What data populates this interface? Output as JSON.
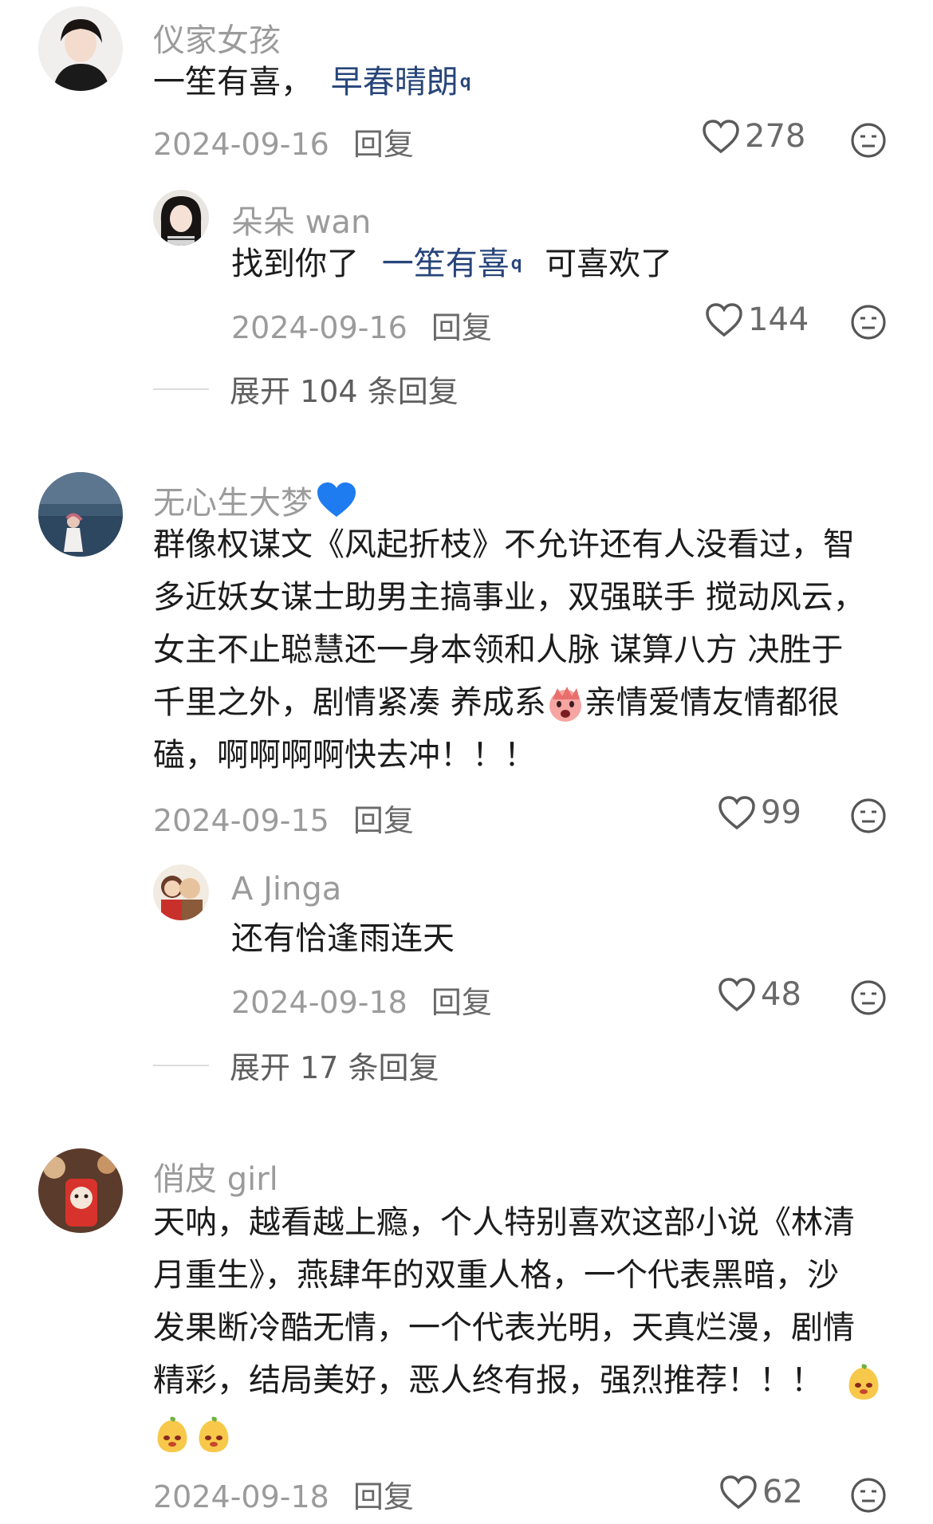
{
  "comments": [
    {
      "user": "仪家女孩",
      "text_plain": "一笙有喜，",
      "text_link": "早春晴朗",
      "date": "2024-09-16",
      "reply_label": "回复",
      "likes": "278",
      "replies": [
        {
          "user": "朵朵 wan",
          "text_plain_before": "找到你了",
          "text_link": "一笙有喜",
          "text_plain_after": "可喜欢了",
          "date": "2024-09-16",
          "reply_label": "回复",
          "likes": "144"
        }
      ],
      "expand_label": "展开 104 条回复"
    },
    {
      "user": "无心生大梦",
      "user_emoji": "blue-heart",
      "lines": [
        "群像权谋文《风起折枝》不允许还有人没看过，智",
        "多近妖女谋士助男主搞事业，双强联手 搅动风云，",
        "女主不止聪慧还一身本领和人脉 谋算八方 决胜于",
        "千里之外，剧情紧凑 养成系",
        "亲情爱情友情都很",
        "磕，啊啊啊啊快去冲！！！"
      ],
      "date": "2024-09-15",
      "reply_label": "回复",
      "likes": "99",
      "replies": [
        {
          "user": "A Jinga",
          "text": "还有恰逢雨连天",
          "date": "2024-09-18",
          "reply_label": "回复",
          "likes": "48"
        }
      ],
      "expand_label": "展开 17 条回复"
    },
    {
      "user": "俏皮 girl",
      "lines": [
        "天呐，越看越上瘾，个人特别喜欢这部小说《林清",
        "月重生》，燕肆年的双重人格，一个代表黑暗，沙",
        "发果断冷酷无情，一个代表光明，天真烂漫，剧情",
        "精彩，结局美好，恶人终有报，强烈推荐！！！"
      ],
      "date": "2024-09-18",
      "reply_label": "回复",
      "likes": "62"
    }
  ],
  "colors": {
    "link": "#27457a",
    "muted": "#9b9b9b",
    "heart_blue": "#1e7cf0"
  }
}
